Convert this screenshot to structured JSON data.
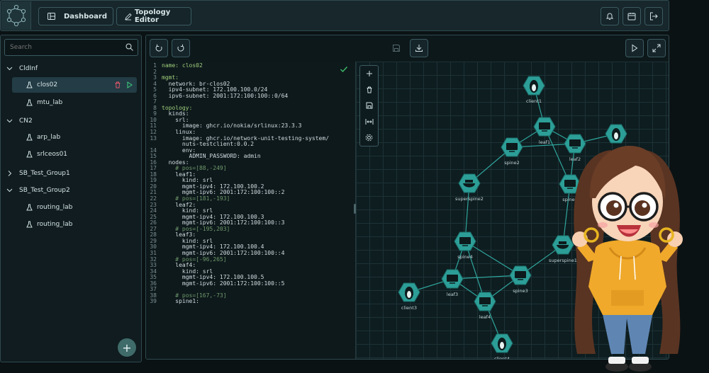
{
  "nav": {
    "dashboard": "Dashboard",
    "topology_editor": "Topology Editor"
  },
  "sidebar": {
    "search_placeholder": "Search",
    "groups": [
      {
        "name": "CldInf",
        "labs": [
          "clos02",
          "mtu_lab"
        ]
      },
      {
        "name": "CN2",
        "labs": [
          "arp_lab",
          "srlceos01"
        ]
      },
      {
        "name": "SB_Test_Group1",
        "labs": []
      },
      {
        "name": "SB_Test_Group2",
        "labs": [
          "routing_lab",
          "routing_lab"
        ]
      }
    ],
    "selected_lab": "clos02"
  },
  "editor": {
    "lines": [
      {
        "n": "1",
        "t": "name: clos02",
        "c": "key"
      },
      {
        "n": "2",
        "t": "",
        "c": ""
      },
      {
        "n": "3",
        "t": "mgmt:",
        "c": "key"
      },
      {
        "n": "4",
        "t": "  network: br-clos02",
        "c": ""
      },
      {
        "n": "5",
        "t": "  ipv4-subnet: 172.100.100.0/24",
        "c": ""
      },
      {
        "n": "6",
        "t": "  ipv6-subnet: 2001:172:100:100::0/64",
        "c": ""
      },
      {
        "n": "7",
        "t": "",
        "c": ""
      },
      {
        "n": "8",
        "t": "topology:",
        "c": "key"
      },
      {
        "n": "9",
        "t": "  kinds:",
        "c": ""
      },
      {
        "n": "10",
        "t": "    srl:",
        "c": ""
      },
      {
        "n": "11",
        "t": "      image: ghcr.io/nokia/srlinux:23.3.3",
        "c": ""
      },
      {
        "n": "12",
        "t": "    linux:",
        "c": ""
      },
      {
        "n": "13",
        "t": "      image: ghcr.io/network-unit-testing-system/",
        "c": ""
      },
      {
        "n": "",
        "t": "      nuts-testclient:0.0.2",
        "c": ""
      },
      {
        "n": "14",
        "t": "      env:",
        "c": ""
      },
      {
        "n": "15",
        "t": "        ADMIN_PASSWORD: admin",
        "c": ""
      },
      {
        "n": "16",
        "t": "  nodes:",
        "c": ""
      },
      {
        "n": "17",
        "t": "    # pos=[88,-249]",
        "c": "cm"
      },
      {
        "n": "18",
        "t": "    leaf1:",
        "c": ""
      },
      {
        "n": "19",
        "t": "      kind: srl",
        "c": ""
      },
      {
        "n": "20",
        "t": "      mgmt-ipv4: 172.100.100.2",
        "c": ""
      },
      {
        "n": "21",
        "t": "      mgmt-ipv6: 2001:172:100:100::2",
        "c": ""
      },
      {
        "n": "22",
        "t": "    # pos=[181,-193]",
        "c": "cm"
      },
      {
        "n": "23",
        "t": "    leaf2:",
        "c": ""
      },
      {
        "n": "24",
        "t": "      kind: srl",
        "c": ""
      },
      {
        "n": "25",
        "t": "      mgmt-ipv4: 172.100.100.3",
        "c": ""
      },
      {
        "n": "26",
        "t": "      mgmt-ipv6: 2001:172:100:100::3",
        "c": ""
      },
      {
        "n": "27",
        "t": "    # pos=[-195,203]",
        "c": "cm"
      },
      {
        "n": "28",
        "t": "    leaf3:",
        "c": ""
      },
      {
        "n": "29",
        "t": "      kind: srl",
        "c": ""
      },
      {
        "n": "30",
        "t": "      mgmt-ipv4: 172.100.100.4",
        "c": ""
      },
      {
        "n": "31",
        "t": "      mgmt-ipv6: 2001:172:100:100::4",
        "c": ""
      },
      {
        "n": "32",
        "t": "    # pos=[-96,265]",
        "c": "cm"
      },
      {
        "n": "33",
        "t": "    leaf4:",
        "c": ""
      },
      {
        "n": "34",
        "t": "      kind: srl",
        "c": ""
      },
      {
        "n": "35",
        "t": "      mgmt-ipv4: 172.100.100.5",
        "c": ""
      },
      {
        "n": "36",
        "t": "      mgmt-ipv6: 2001:172:100:100::5",
        "c": ""
      },
      {
        "n": "37",
        "t": "",
        "c": ""
      },
      {
        "n": "38",
        "t": "    # pos=[167,-73]",
        "c": "cm"
      },
      {
        "n": "39",
        "t": "    spine1:",
        "c": ""
      }
    ]
  },
  "topology": {
    "nodes": [
      {
        "id": "client1",
        "label": "client1",
        "kind": "linux"
      },
      {
        "id": "leaf1",
        "label": "leaf1",
        "kind": "srl"
      },
      {
        "id": "leaf2",
        "label": "leaf2",
        "kind": "srl"
      },
      {
        "id": "client2",
        "label": "",
        "kind": "linux"
      },
      {
        "id": "spine2",
        "label": "spine2",
        "kind": "srl"
      },
      {
        "id": "superspine2",
        "label": "superspine2",
        "kind": "docker"
      },
      {
        "id": "spine1",
        "label": "spine1",
        "kind": "srl"
      },
      {
        "id": "spine4",
        "label": "spine4",
        "kind": "srl"
      },
      {
        "id": "superspine1",
        "label": "superspine1",
        "kind": "docker"
      },
      {
        "id": "leaf3",
        "label": "leaf3",
        "kind": "srl"
      },
      {
        "id": "spine3",
        "label": "spine3",
        "kind": "srl"
      },
      {
        "id": "client3",
        "label": "client3",
        "kind": "linux"
      },
      {
        "id": "leaf4",
        "label": "leaf4",
        "kind": "srl"
      },
      {
        "id": "client4",
        "label": "client4",
        "kind": "linux"
      }
    ],
    "links": [
      [
        "client1",
        "leaf1"
      ],
      [
        "leaf1",
        "spine2"
      ],
      [
        "leaf1",
        "leaf2"
      ],
      [
        "leaf1",
        "spine1"
      ],
      [
        "leaf2",
        "client2"
      ],
      [
        "leaf2",
        "spine2"
      ],
      [
        "leaf2",
        "spine1"
      ],
      [
        "spine2",
        "superspine2"
      ],
      [
        "superspine2",
        "spine4"
      ],
      [
        "spine4",
        "leaf3"
      ],
      [
        "spine4",
        "spine3"
      ],
      [
        "spine1",
        "superspine1"
      ],
      [
        "superspine1",
        "spine3"
      ],
      [
        "leaf3",
        "spine3"
      ],
      [
        "leaf3",
        "client3"
      ],
      [
        "leaf3",
        "leaf4"
      ],
      [
        "spine3",
        "leaf4"
      ],
      [
        "leaf4",
        "client4"
      ],
      [
        "spine4",
        "leaf4"
      ]
    ]
  },
  "colors": {
    "accent": "#2fb3a9",
    "node_fill": "#2c9e97",
    "link": "#2fa59c",
    "valid_check": "#3fbf6a",
    "delete": "#e0566a",
    "run": "#3fd07f"
  }
}
